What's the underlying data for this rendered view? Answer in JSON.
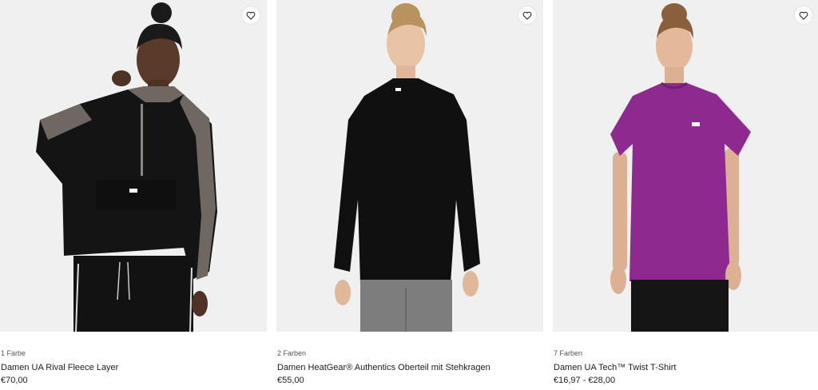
{
  "products": [
    {
      "colors_label": "1 Farbe",
      "name": "Damen UA Rival Fleece Layer",
      "price": "€70,00",
      "favorite_icon": "heart-outline-icon"
    },
    {
      "colors_label": "2 Farben",
      "name": "Damen HeatGear® Authentics Oberteil mit Stehkragen",
      "price": "€55,00",
      "favorite_icon": "heart-outline-icon"
    },
    {
      "colors_label": "7 Farben",
      "name": "Damen UA Tech™ Twist T-Shirt",
      "price": "€16,97 - €28,00",
      "favorite_icon": "heart-outline-icon"
    }
  ],
  "colors": {
    "image_bg": "#f0f0f0",
    "text_primary": "#1d1d1d",
    "text_secondary": "#555555",
    "shirt_purple": "#8e2a8f"
  }
}
